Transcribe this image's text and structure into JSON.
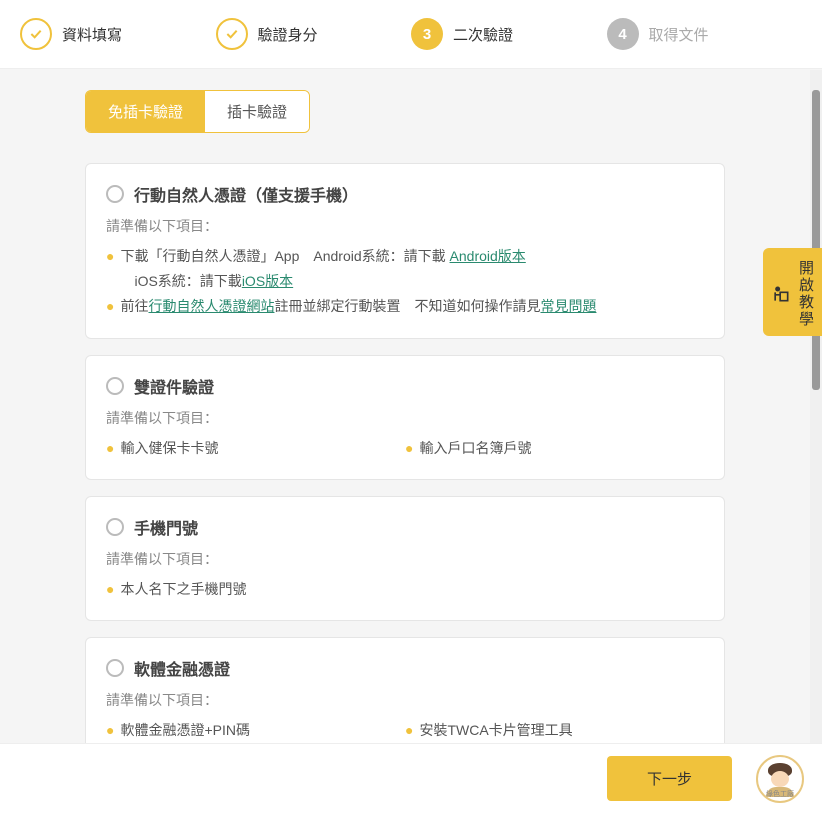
{
  "stepper": {
    "steps": [
      {
        "label": "資料填寫",
        "state": "done"
      },
      {
        "label": "驗證身分",
        "state": "done"
      },
      {
        "num": "3",
        "label": "二次驗證",
        "state": "active"
      },
      {
        "num": "4",
        "label": "取得文件",
        "state": "inactive"
      }
    ]
  },
  "tabs": {
    "t1": "免插卡驗證",
    "t2": "插卡驗證"
  },
  "prepare_label": "請準備以下項目：",
  "cards": {
    "c1": {
      "title": "行動自然人憑證（僅支援手機）",
      "line1a": "下載「行動自然人憑證」App　Android系統：請下載 ",
      "link1": "Android版本",
      "line1b": "iOS系統：請下載",
      "link2": "iOS版本",
      "line2a": "前往",
      "link3": "行動自然人憑證網站",
      "line2b": "註冊並綁定行動裝置　不知道如何操作請見",
      "link4": "常見問題"
    },
    "c2": {
      "title": "雙證件驗證",
      "b1": "輸入健保卡卡號",
      "b2": "輸入戶口名簿戶號"
    },
    "c3": {
      "title": "手機門號",
      "b1": "本人名下之手機門號"
    },
    "c4": {
      "title": "軟體金融憑證",
      "b1": "軟體金融憑證+PIN碼",
      "b2": "安裝TWCA卡片管理工具"
    }
  },
  "side_tab": "開啟教學",
  "next_button": "下一步",
  "avatar_label": "綠色工廠"
}
